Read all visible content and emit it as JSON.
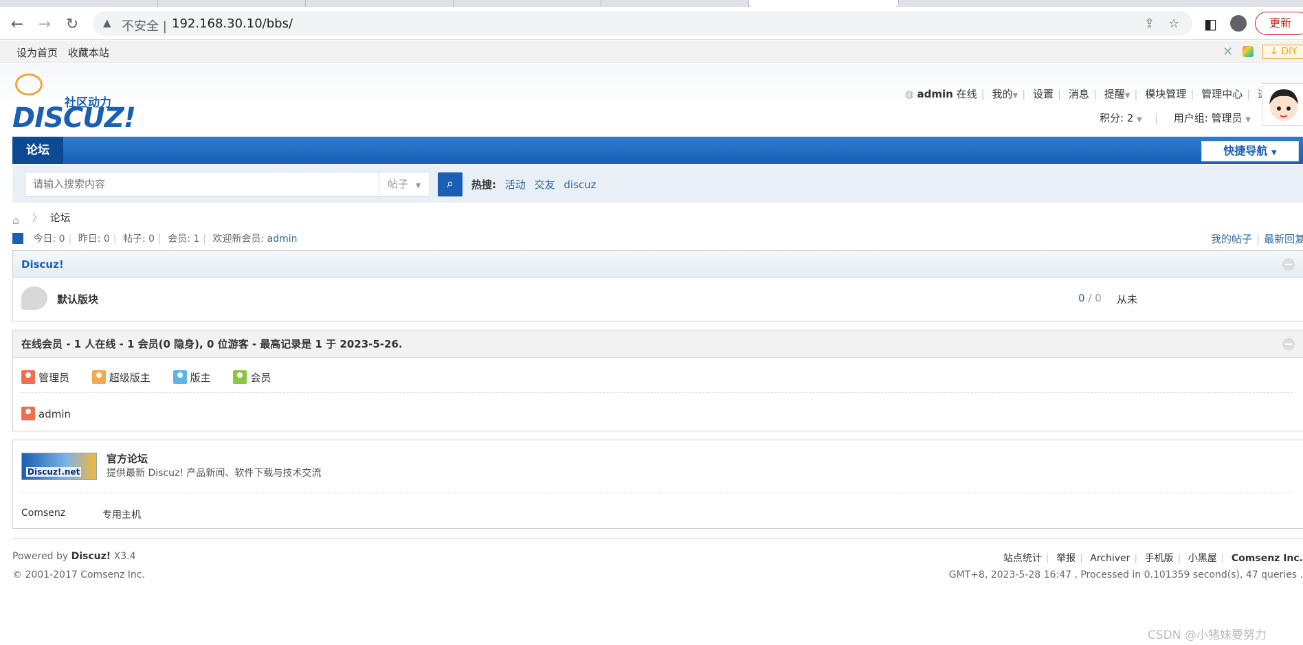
{
  "browser": {
    "security_label": "不安全 |",
    "url": "192.168.30.10/bbs/",
    "update_label": "更新"
  },
  "topbar": {
    "set_home": "设为首页",
    "bookmark": "收藏本站",
    "diy": "DIY"
  },
  "header": {
    "logo_text": "DISCUZ!",
    "logo_cn": "社区动力",
    "username": "admin",
    "online": "在线",
    "menu": [
      "我的",
      "设置",
      "消息",
      "提醒",
      "模块管理",
      "管理中心",
      "退出"
    ],
    "credits": "积分: 2",
    "usergroup": "用户组: 管理员"
  },
  "nav": {
    "forum": "论坛",
    "quick_nav": "快捷导航"
  },
  "search": {
    "placeholder": "请输入搜索内容",
    "type": "帖子",
    "hot_label": "热搜:",
    "hot_terms": [
      "活动",
      "交友",
      "discuz"
    ]
  },
  "breadcrumb": {
    "current": "论坛"
  },
  "stats": {
    "today": "今日: 0",
    "yesterday": "昨日: 0",
    "posts": "帖子: 0",
    "members": "会员: 1",
    "welcome": "欢迎新会员:",
    "new_member": "admin",
    "my_posts": "我的帖子",
    "latest_reply": "最新回复"
  },
  "category": {
    "title": "Discuz!",
    "forum_name": "默认版块",
    "threads": "0",
    "posts": "/ 0",
    "last_post": "从未"
  },
  "online": {
    "title": "在线会员 - 1 人在线 - 1 会员(0 隐身), 0 位游客 - 最高记录是 1 于 2023-5-26.",
    "legend": [
      {
        "label": "管理员",
        "color": "#f26c4f"
      },
      {
        "label": "超级版主",
        "color": "#f5a94a"
      },
      {
        "label": "版主",
        "color": "#5ab6e6"
      },
      {
        "label": "会员",
        "color": "#8cc63f"
      }
    ],
    "user": "admin"
  },
  "links": {
    "banner_text": "Discuz!.net",
    "title": "官方论坛",
    "desc": "提供最新 Discuz! 产品新闻、软件下载与技术交流",
    "text_links": [
      "Comsenz",
      "专用主机"
    ]
  },
  "footer": {
    "powered_prefix": "Powered by",
    "powered_brand": "Discuz!",
    "version": "X3.4",
    "copyright": "© 2001-2017 Comsenz Inc.",
    "links": [
      "站点统计",
      "举报",
      "Archiver",
      "手机版",
      "小黑屋"
    ],
    "company": "Comsenz Inc.",
    "stats": "GMT+8, 2023-5-28 16:47 , Processed in 0.101359 second(s), 47 queries ."
  },
  "watermark": "CSDN @小猪妹要努力"
}
